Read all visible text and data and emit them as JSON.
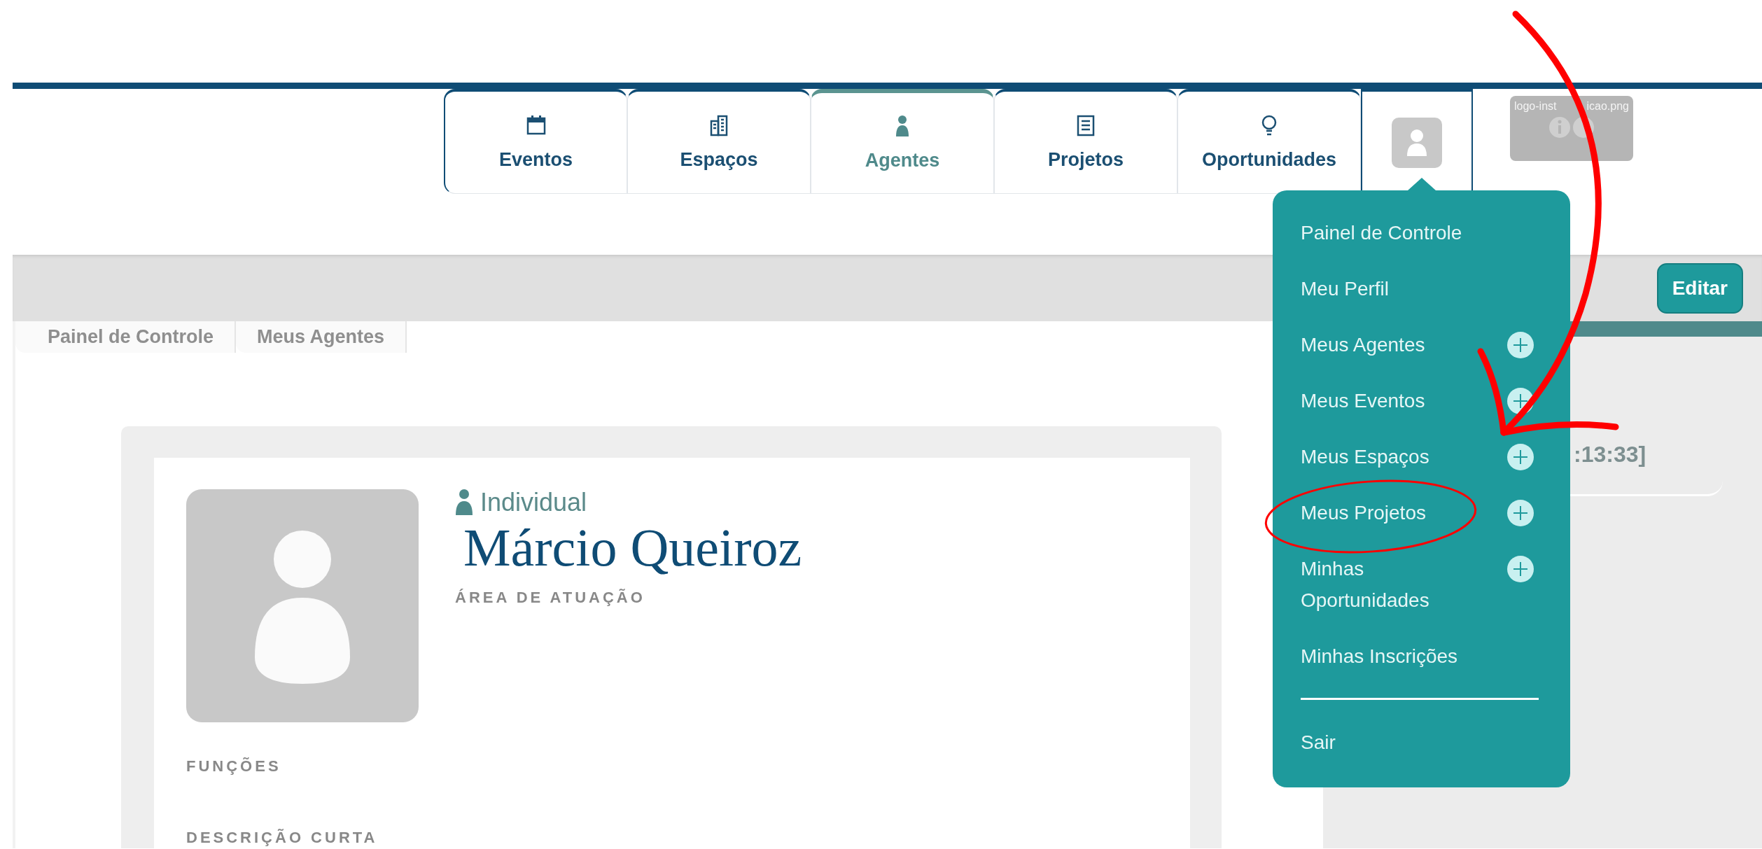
{
  "nav": {
    "tabs": [
      {
        "label": "Eventos",
        "selected": false
      },
      {
        "label": "Espaços",
        "selected": false
      },
      {
        "label": "Agentes",
        "selected": true
      },
      {
        "label": "Projetos",
        "selected": false
      },
      {
        "label": "Oportunidades",
        "selected": false
      }
    ],
    "logo_placeholder": {
      "filename_parts": [
        "logo-inst",
        "icao.png"
      ]
    }
  },
  "user_menu": {
    "expanded": true,
    "items": [
      {
        "label": "Painel de Controle",
        "has_add": false
      },
      {
        "label": "Meu Perfil",
        "has_add": false
      },
      {
        "label": "Meus Agentes",
        "has_add": true
      },
      {
        "label": "Meus Eventos",
        "has_add": true
      },
      {
        "label": "Meus Espaços",
        "has_add": true
      },
      {
        "label": "Meus Projetos",
        "has_add": true
      },
      {
        "label": "Minhas Oportunidades",
        "has_add": true
      },
      {
        "label": "Minhas Inscrições",
        "has_add": false
      }
    ],
    "logout": "Sair"
  },
  "toolbar": {
    "edit_button": "Editar"
  },
  "breadcrumb": [
    "Painel de Controle",
    "Meus Agentes"
  ],
  "profile": {
    "type": "Individual",
    "name": "Márcio Queiroz",
    "sections": [
      "ÁREA DE ATUAÇÃO",
      "FUNÇÕES",
      "DESCRIÇÃO CURTA"
    ]
  },
  "side_panel": {
    "timestamp_fragment": ":13:33]"
  }
}
